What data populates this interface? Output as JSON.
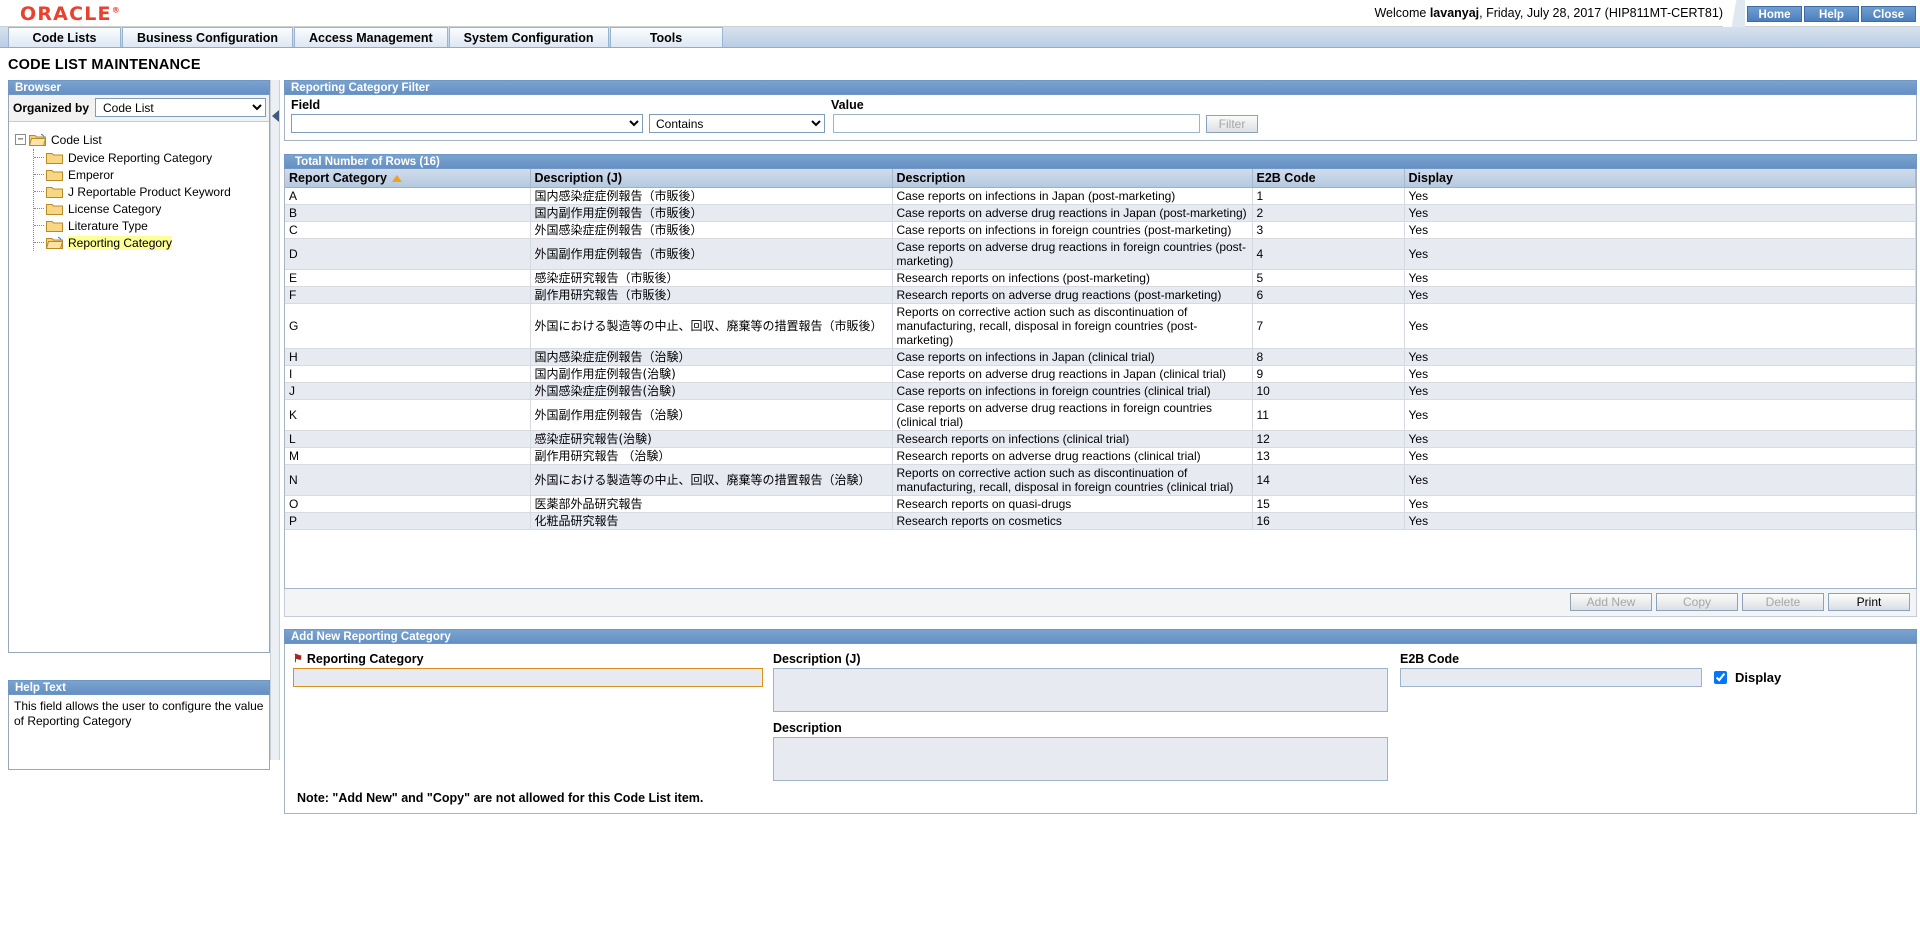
{
  "header": {
    "logo_text": "ORACLE",
    "welcome_prefix": "Welcome ",
    "user": "lavanyaj",
    "welcome_suffix": ", Friday, July 28, 2017 (HIP811MT-CERT81)",
    "buttons": [
      {
        "label": "Home",
        "name": "home-button"
      },
      {
        "label": "Help",
        "name": "help-button"
      },
      {
        "label": "Close",
        "name": "close-button"
      }
    ]
  },
  "nav_tabs": [
    {
      "label": "Code Lists"
    },
    {
      "label": "Business Configuration"
    },
    {
      "label": "Access Management"
    },
    {
      "label": "System Configuration"
    },
    {
      "label": "Tools"
    }
  ],
  "page_title": "CODE LIST MAINTENANCE",
  "browser": {
    "title": "Browser",
    "organized_by_label": "Organized by",
    "organized_by_value": "Code List",
    "organized_by_options": [
      "Code List"
    ],
    "tree_root": "Code List",
    "tree_items": [
      {
        "label": "Device Reporting Category",
        "selected": false
      },
      {
        "label": "Emperor",
        "selected": false
      },
      {
        "label": "J Reportable Product Keyword",
        "selected": false
      },
      {
        "label": "License Category",
        "selected": false
      },
      {
        "label": "Literature Type",
        "selected": false
      },
      {
        "label": "Reporting Category",
        "selected": true
      }
    ]
  },
  "help": {
    "title": "Help Text",
    "text": "This field allows the user to configure the value of Reporting Category"
  },
  "filter": {
    "title": "Reporting Category Filter",
    "field_label": "Field",
    "field_value": "",
    "field_options": [
      ""
    ],
    "operator_value": "Contains",
    "operator_options": [
      "Contains"
    ],
    "value_label": "Value",
    "value_text": "",
    "filter_button": "Filter"
  },
  "grid": {
    "title": "Total Number of Rows (16)",
    "columns": [
      {
        "label": "Report Category",
        "sorted": true
      },
      {
        "label": "Description (J)",
        "sorted": false
      },
      {
        "label": "Description",
        "sorted": false
      },
      {
        "label": "E2B Code",
        "sorted": false
      },
      {
        "label": "Display",
        "sorted": false
      }
    ],
    "rows": [
      {
        "category": "A",
        "desc_j": "国内感染症症例報告（市販後）",
        "desc": "Case reports on infections in Japan (post-marketing)",
        "e2b": "1",
        "display": "Yes"
      },
      {
        "category": "B",
        "desc_j": "国内副作用症例報告（市販後）",
        "desc": "Case reports on adverse drug reactions in Japan (post-marketing)",
        "e2b": "2",
        "display": "Yes"
      },
      {
        "category": "C",
        "desc_j": "外国感染症症例報告（市販後）",
        "desc": "Case reports on infections in foreign countries (post-marketing)",
        "e2b": "3",
        "display": "Yes"
      },
      {
        "category": "D",
        "desc_j": "外国副作用症例報告（市販後）",
        "desc": "Case reports on adverse drug reactions in foreign countries (post-marketing)",
        "e2b": "4",
        "display": "Yes"
      },
      {
        "category": "E",
        "desc_j": "感染症研究報告（市販後）",
        "desc": "Research reports on infections (post-marketing)",
        "e2b": "5",
        "display": "Yes"
      },
      {
        "category": "F",
        "desc_j": "副作用研究報告（市販後）",
        "desc": "Research reports on adverse drug reactions (post-marketing)",
        "e2b": "6",
        "display": "Yes"
      },
      {
        "category": "G",
        "desc_j": "外国における製造等の中止、回収、廃棄等の措置報告（市販後）",
        "desc": "Reports on corrective action such as discontinuation of manufacturing, recall, disposal in foreign countries (post-marketing)",
        "e2b": "7",
        "display": "Yes"
      },
      {
        "category": "H",
        "desc_j": "国内感染症症例報告（治験）",
        "desc": "Case reports on infections in Japan (clinical trial)",
        "e2b": "8",
        "display": "Yes"
      },
      {
        "category": "I",
        "desc_j": "国内副作用症例報告(治験)",
        "desc": "Case reports on adverse drug reactions in Japan (clinical trial)",
        "e2b": "9",
        "display": "Yes"
      },
      {
        "category": "J",
        "desc_j": "外国感染症症例報告(治験)",
        "desc": "Case reports on infections in foreign countries (clinical trial)",
        "e2b": "10",
        "display": "Yes"
      },
      {
        "category": "K",
        "desc_j": "外国副作用症例報告（治験）",
        "desc": "Case reports on adverse drug reactions in foreign countries (clinical trial)",
        "e2b": "11",
        "display": "Yes"
      },
      {
        "category": "L",
        "desc_j": "感染症研究報告(治験)",
        "desc": "Research reports on infections (clinical trial)",
        "e2b": "12",
        "display": "Yes"
      },
      {
        "category": "M",
        "desc_j": "副作用研究報告 （治験）",
        "desc": "Research reports on adverse drug reactions (clinical trial)",
        "e2b": "13",
        "display": "Yes"
      },
      {
        "category": "N",
        "desc_j": "外国における製造等の中止、回収、廃棄等の措置報告（治験）",
        "desc": "Reports on corrective action such as discontinuation of manufacturing, recall, disposal in foreign countries (clinical trial)",
        "e2b": "14",
        "display": "Yes"
      },
      {
        "category": "O",
        "desc_j": "医薬部外品研究報告",
        "desc": "Research reports on quasi-drugs",
        "e2b": "15",
        "display": "Yes"
      },
      {
        "category": "P",
        "desc_j": "化粧品研究報告",
        "desc": "Research reports on cosmetics",
        "e2b": "16",
        "display": "Yes"
      }
    ],
    "actions": [
      {
        "label": "Add New",
        "enabled": false
      },
      {
        "label": "Copy",
        "enabled": false
      },
      {
        "label": "Delete",
        "enabled": false
      },
      {
        "label": "Print",
        "enabled": true
      }
    ]
  },
  "addnew": {
    "title": "Add New Reporting Category",
    "category_label": "Reporting Category",
    "category_value": "",
    "desc_j_label": "Description (J)",
    "desc_j_value": "",
    "desc_label": "Description",
    "desc_value": "",
    "e2b_label": "E2B Code",
    "e2b_value": "",
    "display_label": "Display",
    "display_checked": true,
    "note": "Note: \"Add New\" and \"Copy\" are not allowed for this Code List item."
  }
}
